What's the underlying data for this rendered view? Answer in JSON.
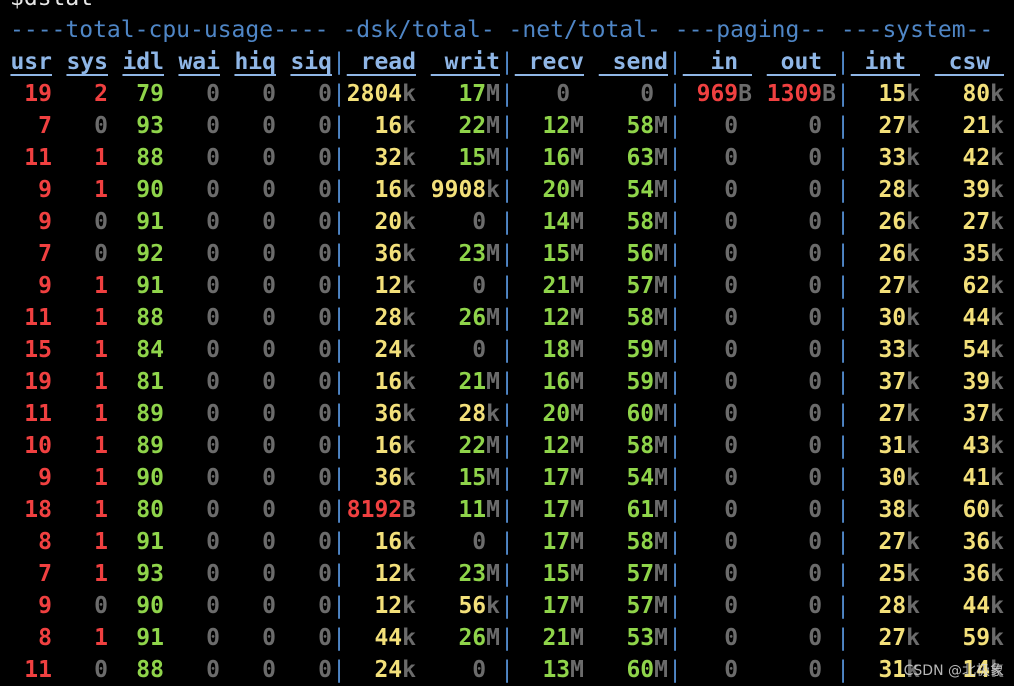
{
  "prompt": "$dstat",
  "groups": {
    "cpu": "----total-cpu-usage----",
    "dsk": "-dsk/total-",
    "net": "-net/total-",
    "paging": "---paging--",
    "system": "---system--"
  },
  "headers": [
    "usr",
    "sys",
    "idl",
    "wai",
    "hiq",
    "siq",
    "read",
    "writ",
    "recv",
    "send",
    "in",
    "out",
    "int",
    "csw"
  ],
  "rows": [
    {
      "usr": "19",
      "sys": "2",
      "idl": "79",
      "wai": "0",
      "hiq": "0",
      "siq": "0",
      "read": [
        "2804",
        "k"
      ],
      "writ": [
        "17",
        "M"
      ],
      "recv": [
        "0",
        ""
      ],
      "send": [
        "0",
        ""
      ],
      "in": [
        "969",
        "B"
      ],
      "out": [
        "1309",
        "B"
      ],
      "int": [
        "15",
        "k"
      ],
      "csw": [
        "80",
        "k"
      ]
    },
    {
      "usr": "7",
      "sys": "0",
      "idl": "93",
      "wai": "0",
      "hiq": "0",
      "siq": "0",
      "read": [
        "16",
        "k"
      ],
      "writ": [
        "22",
        "M"
      ],
      "recv": [
        "12",
        "M"
      ],
      "send": [
        "58",
        "M"
      ],
      "in": [
        "0",
        ""
      ],
      "out": [
        "0",
        ""
      ],
      "int": [
        "27",
        "k"
      ],
      "csw": [
        "21",
        "k"
      ]
    },
    {
      "usr": "11",
      "sys": "1",
      "idl": "88",
      "wai": "0",
      "hiq": "0",
      "siq": "0",
      "read": [
        "32",
        "k"
      ],
      "writ": [
        "15",
        "M"
      ],
      "recv": [
        "16",
        "M"
      ],
      "send": [
        "63",
        "M"
      ],
      "in": [
        "0",
        ""
      ],
      "out": [
        "0",
        ""
      ],
      "int": [
        "33",
        "k"
      ],
      "csw": [
        "42",
        "k"
      ]
    },
    {
      "usr": "9",
      "sys": "1",
      "idl": "90",
      "wai": "0",
      "hiq": "0",
      "siq": "0",
      "read": [
        "16",
        "k"
      ],
      "writ": [
        "9908",
        "k"
      ],
      "recv": [
        "20",
        "M"
      ],
      "send": [
        "54",
        "M"
      ],
      "in": [
        "0",
        ""
      ],
      "out": [
        "0",
        ""
      ],
      "int": [
        "28",
        "k"
      ],
      "csw": [
        "39",
        "k"
      ]
    },
    {
      "usr": "9",
      "sys": "0",
      "idl": "91",
      "wai": "0",
      "hiq": "0",
      "siq": "0",
      "read": [
        "20",
        "k"
      ],
      "writ": [
        "0",
        ""
      ],
      "recv": [
        "14",
        "M"
      ],
      "send": [
        "58",
        "M"
      ],
      "in": [
        "0",
        ""
      ],
      "out": [
        "0",
        ""
      ],
      "int": [
        "26",
        "k"
      ],
      "csw": [
        "27",
        "k"
      ]
    },
    {
      "usr": "7",
      "sys": "0",
      "idl": "92",
      "wai": "0",
      "hiq": "0",
      "siq": "0",
      "read": [
        "36",
        "k"
      ],
      "writ": [
        "23",
        "M"
      ],
      "recv": [
        "15",
        "M"
      ],
      "send": [
        "56",
        "M"
      ],
      "in": [
        "0",
        ""
      ],
      "out": [
        "0",
        ""
      ],
      "int": [
        "26",
        "k"
      ],
      "csw": [
        "35",
        "k"
      ]
    },
    {
      "usr": "9",
      "sys": "1",
      "idl": "91",
      "wai": "0",
      "hiq": "0",
      "siq": "0",
      "read": [
        "12",
        "k"
      ],
      "writ": [
        "0",
        ""
      ],
      "recv": [
        "21",
        "M"
      ],
      "send": [
        "57",
        "M"
      ],
      "in": [
        "0",
        ""
      ],
      "out": [
        "0",
        ""
      ],
      "int": [
        "27",
        "k"
      ],
      "csw": [
        "62",
        "k"
      ]
    },
    {
      "usr": "11",
      "sys": "1",
      "idl": "88",
      "wai": "0",
      "hiq": "0",
      "siq": "0",
      "read": [
        "28",
        "k"
      ],
      "writ": [
        "26",
        "M"
      ],
      "recv": [
        "12",
        "M"
      ],
      "send": [
        "58",
        "M"
      ],
      "in": [
        "0",
        ""
      ],
      "out": [
        "0",
        ""
      ],
      "int": [
        "30",
        "k"
      ],
      "csw": [
        "44",
        "k"
      ]
    },
    {
      "usr": "15",
      "sys": "1",
      "idl": "84",
      "wai": "0",
      "hiq": "0",
      "siq": "0",
      "read": [
        "24",
        "k"
      ],
      "writ": [
        "0",
        ""
      ],
      "recv": [
        "18",
        "M"
      ],
      "send": [
        "59",
        "M"
      ],
      "in": [
        "0",
        ""
      ],
      "out": [
        "0",
        ""
      ],
      "int": [
        "33",
        "k"
      ],
      "csw": [
        "54",
        "k"
      ]
    },
    {
      "usr": "19",
      "sys": "1",
      "idl": "81",
      "wai": "0",
      "hiq": "0",
      "siq": "0",
      "read": [
        "16",
        "k"
      ],
      "writ": [
        "21",
        "M"
      ],
      "recv": [
        "16",
        "M"
      ],
      "send": [
        "59",
        "M"
      ],
      "in": [
        "0",
        ""
      ],
      "out": [
        "0",
        ""
      ],
      "int": [
        "37",
        "k"
      ],
      "csw": [
        "39",
        "k"
      ]
    },
    {
      "usr": "11",
      "sys": "1",
      "idl": "89",
      "wai": "0",
      "hiq": "0",
      "siq": "0",
      "read": [
        "36",
        "k"
      ],
      "writ": [
        "28",
        "k"
      ],
      "recv": [
        "20",
        "M"
      ],
      "send": [
        "60",
        "M"
      ],
      "in": [
        "0",
        ""
      ],
      "out": [
        "0",
        ""
      ],
      "int": [
        "27",
        "k"
      ],
      "csw": [
        "37",
        "k"
      ]
    },
    {
      "usr": "10",
      "sys": "1",
      "idl": "89",
      "wai": "0",
      "hiq": "0",
      "siq": "0",
      "read": [
        "16",
        "k"
      ],
      "writ": [
        "22",
        "M"
      ],
      "recv": [
        "12",
        "M"
      ],
      "send": [
        "58",
        "M"
      ],
      "in": [
        "0",
        ""
      ],
      "out": [
        "0",
        ""
      ],
      "int": [
        "31",
        "k"
      ],
      "csw": [
        "43",
        "k"
      ]
    },
    {
      "usr": "9",
      "sys": "1",
      "idl": "90",
      "wai": "0",
      "hiq": "0",
      "siq": "0",
      "read": [
        "36",
        "k"
      ],
      "writ": [
        "15",
        "M"
      ],
      "recv": [
        "17",
        "M"
      ],
      "send": [
        "54",
        "M"
      ],
      "in": [
        "0",
        ""
      ],
      "out": [
        "0",
        ""
      ],
      "int": [
        "30",
        "k"
      ],
      "csw": [
        "41",
        "k"
      ]
    },
    {
      "usr": "18",
      "sys": "1",
      "idl": "80",
      "wai": "0",
      "hiq": "0",
      "siq": "0",
      "read": [
        "8192",
        "B"
      ],
      "writ": [
        "11",
        "M"
      ],
      "recv": [
        "17",
        "M"
      ],
      "send": [
        "61",
        "M"
      ],
      "in": [
        "0",
        ""
      ],
      "out": [
        "0",
        ""
      ],
      "int": [
        "38",
        "k"
      ],
      "csw": [
        "60",
        "k"
      ]
    },
    {
      "usr": "8",
      "sys": "1",
      "idl": "91",
      "wai": "0",
      "hiq": "0",
      "siq": "0",
      "read": [
        "16",
        "k"
      ],
      "writ": [
        "0",
        ""
      ],
      "recv": [
        "17",
        "M"
      ],
      "send": [
        "58",
        "M"
      ],
      "in": [
        "0",
        ""
      ],
      "out": [
        "0",
        ""
      ],
      "int": [
        "27",
        "k"
      ],
      "csw": [
        "36",
        "k"
      ]
    },
    {
      "usr": "7",
      "sys": "1",
      "idl": "93",
      "wai": "0",
      "hiq": "0",
      "siq": "0",
      "read": [
        "12",
        "k"
      ],
      "writ": [
        "23",
        "M"
      ],
      "recv": [
        "15",
        "M"
      ],
      "send": [
        "57",
        "M"
      ],
      "in": [
        "0",
        ""
      ],
      "out": [
        "0",
        ""
      ],
      "int": [
        "25",
        "k"
      ],
      "csw": [
        "36",
        "k"
      ]
    },
    {
      "usr": "9",
      "sys": "0",
      "idl": "90",
      "wai": "0",
      "hiq": "0",
      "siq": "0",
      "read": [
        "12",
        "k"
      ],
      "writ": [
        "56",
        "k"
      ],
      "recv": [
        "17",
        "M"
      ],
      "send": [
        "57",
        "M"
      ],
      "in": [
        "0",
        ""
      ],
      "out": [
        "0",
        ""
      ],
      "int": [
        "28",
        "k"
      ],
      "csw": [
        "44",
        "k"
      ]
    },
    {
      "usr": "8",
      "sys": "1",
      "idl": "91",
      "wai": "0",
      "hiq": "0",
      "siq": "0",
      "read": [
        "44",
        "k"
      ],
      "writ": [
        "26",
        "M"
      ],
      "recv": [
        "21",
        "M"
      ],
      "send": [
        "53",
        "M"
      ],
      "in": [
        "0",
        ""
      ],
      "out": [
        "0",
        ""
      ],
      "int": [
        "27",
        "k"
      ],
      "csw": [
        "59",
        "k"
      ]
    },
    {
      "usr": "11",
      "sys": "0",
      "idl": "88",
      "wai": "0",
      "hiq": "0",
      "siq": "0",
      "read": [
        "24",
        "k"
      ],
      "writ": [
        "0",
        ""
      ],
      "recv": [
        "13",
        "M"
      ],
      "send": [
        "60",
        "M"
      ],
      "in": [
        "0",
        ""
      ],
      "out": [
        "0",
        ""
      ],
      "int": [
        "31",
        "k"
      ],
      "csw": [
        "14",
        "k"
      ]
    }
  ],
  "watermark": "CSDN @北极象"
}
